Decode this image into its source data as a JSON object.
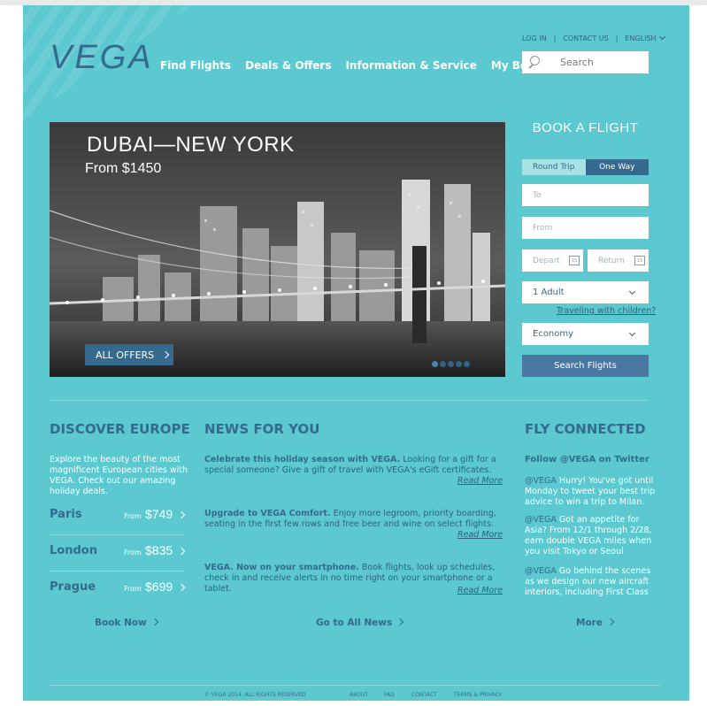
{
  "logo": "VEGA",
  "main_nav": [
    "Find Flights",
    "Deals & Offers",
    "Information & Service",
    "My Booking"
  ],
  "util_nav": {
    "login": "LOG IN",
    "contact": "CONTACT US",
    "language": "ENGLISH",
    "separator": "|"
  },
  "search": {
    "placeholder": "Search"
  },
  "hero": {
    "title": "DUBAI—NEW YORK",
    "price": "From $1450",
    "button": "ALL OFFERS",
    "slides": 5
  },
  "booking": {
    "title": "BOOK A FLIGHT",
    "tabs": [
      "Round Trip",
      "One Way"
    ],
    "to_placeholder": "To",
    "from_placeholder": "From",
    "depart_placeholder": "Depart",
    "return_placeholder": "Return",
    "calendar_day": "15",
    "passengers": "1 Adult",
    "children_link": "Traveling with children?",
    "cabin": "Economy",
    "submit": "Search Flights"
  },
  "europe": {
    "title": "DISCOVER EUROPE",
    "intro": "Explore the beauty of the most magnificent European cities with VEGA. Check out our amazing holiday deals.",
    "cities": [
      {
        "name": "Paris",
        "from": "From",
        "price": "$749"
      },
      {
        "name": "London",
        "from": "From",
        "price": "$835"
      },
      {
        "name": "Prague",
        "from": "From",
        "price": "$699"
      }
    ],
    "cta": "Book Now"
  },
  "news": {
    "title": "NEWS FOR YOU",
    "items": [
      {
        "headline": "Celebrate this holiday season with VEGA.",
        "text": "Looking for a gift for a special someone? Give a gift of travel with VEGA's eGift certificates.",
        "more": "Read More"
      },
      {
        "headline": "Upgrade to VEGA Comfort.",
        "text": "Enjoy more legroom, priority boarding, seating in the first few rows and free beer and wine on select flights.",
        "more": "Read More"
      },
      {
        "headline": "VEGA. Now on your smartphone.",
        "text": "Book flights, look up schedules, check in and receive alerts in no time right on your smartphone or a tablet.",
        "more": "Read More"
      }
    ],
    "cta": "Go to All News"
  },
  "connected": {
    "title": "FLY CONNECTED",
    "subtitle": "Follow @VEGA on Twitter",
    "tweets": [
      {
        "handle": "@VEGA",
        "text": "Hurry! You've got until Monday to tweet your best trip advice to win a trip to Milan."
      },
      {
        "handle": "@VEGA",
        "text": "Got an appetite for Asia? From 12/1 through 2/28, earn double VEGA miles when you visit Tokyo or Seoul"
      },
      {
        "handle": "@VEGA",
        "text": "Go behind the scenes as we design our new aircraft interiors, including First Class"
      }
    ],
    "cta": "More"
  },
  "footer": {
    "copyright": "© VEGA 2014. ALL RIGHTS RESERVED",
    "links": [
      "ABOUT",
      "FAQ",
      "CONTACT",
      "TERMS & PRIVACY"
    ]
  },
  "colors": {
    "background": "#5bc9cf",
    "brand": "#356a8e",
    "button": "#4a78a0"
  }
}
